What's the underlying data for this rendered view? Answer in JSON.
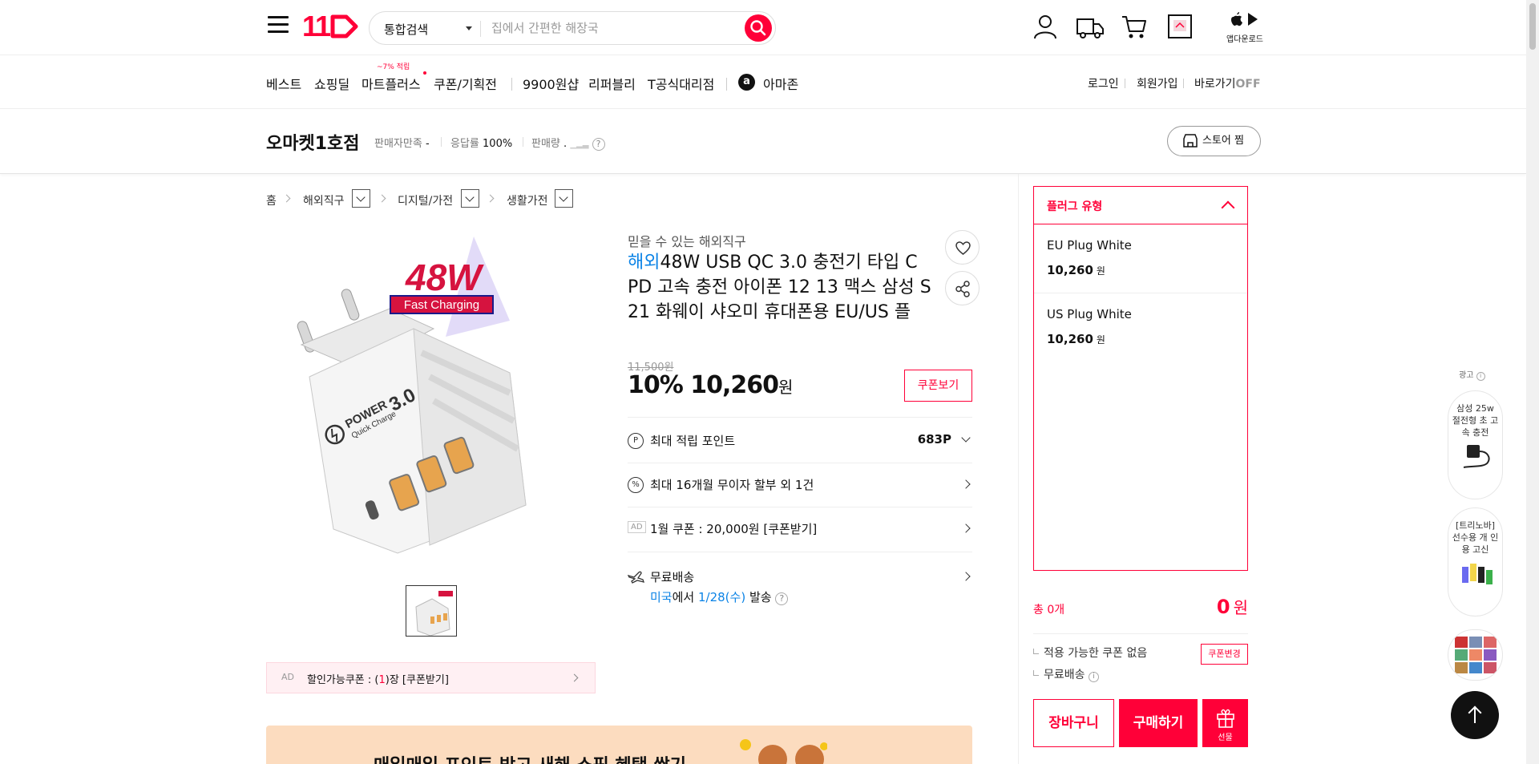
{
  "header": {
    "logo_text": "11",
    "search": {
      "category": "통합검색",
      "placeholder": "집에서 간편한 해장국"
    },
    "app_download": "앱다운로드"
  },
  "gnb": {
    "items": [
      "베스트",
      "쇼핑딜",
      "마트플러스",
      "쿠폰/기획전",
      "9900원샵",
      "리퍼블리",
      "T공식대리점",
      "아마존"
    ],
    "mart_badge": "~7% 적립",
    "amazon_logo": "a",
    "right": {
      "login": "로그인",
      "join": "회원가입",
      "shortcut": "바로가기",
      "shortcut_state": "OFF"
    }
  },
  "seller": {
    "name": "오마켓1호점",
    "satisfaction_label": "판매자만족",
    "satisfaction_value": "-",
    "response_label": "응답률",
    "response_value": "100%",
    "sales_label": "판매량",
    "sales_value": ".",
    "help": "?",
    "store_button": "스토어 찜"
  },
  "breadcrumb": [
    "홈",
    "해외직구",
    "디지털/가전",
    "생활가전"
  ],
  "product": {
    "image_badge_watt": "48W",
    "image_badge_text": "Fast Charging",
    "image_print_main": "POWER",
    "image_print_sub": "Quick Charge",
    "image_print_version": "3.0",
    "pre_title": "믿을 수 있는 해외직구",
    "flag": "해외",
    "title": "48W USB QC 3.0 충전기 타입 C PD 고속 충전 아이폰 12 13 맥스 삼성 S21 화웨이 샤오미 휴대폰용 EU/US 플",
    "original_price": "11,500원",
    "discount": "10%",
    "price": "10,260",
    "currency": "원",
    "coupon_button": "쿠폰보기",
    "points_label": "최대 적립 포인트",
    "points_value": "683P",
    "installment": "최대 16개월 무이자 할부 외 1건",
    "ad_tag": "AD",
    "monthly_coupon": "1월 쿠폰 : 20,000원 [쿠폰받기]",
    "shipping": "무료배송",
    "ship_origin": "미국",
    "ship_mid": "에서 ",
    "ship_date": "1/28(수)",
    "ship_suffix": " 발송",
    "points_icon": "P",
    "installment_icon": "%",
    "help": "?"
  },
  "discount_coupon": {
    "ad_tag": "AD",
    "prefix": "할인가능쿠폰 : (",
    "count": "1",
    "suffix": ")장 [쿠폰받기]"
  },
  "banner": {
    "text": "매일매일 포인트 받고 새해 쇼핑 혜택 쌓기"
  },
  "options": {
    "header": "플러그 유형",
    "items": [
      {
        "name": "EU Plug White",
        "price": "10,260",
        "unit": "원"
      },
      {
        "name": "US Plug White",
        "price": "10,260",
        "unit": "원"
      }
    ]
  },
  "order": {
    "count": "총 0개",
    "total": "0",
    "total_unit": "원",
    "coupon_status": "적용 가능한 쿠폰 없음",
    "coupon_change": "쿠폰변경",
    "shipping": "무료배송",
    "cart": "장바구니",
    "buy": "구매하기",
    "gift": "선물"
  },
  "side_ads": {
    "label": "광고",
    "items": [
      "삼성 25w 절전형 초 고속 충전",
      "[트리노바] 선수용 개 인용 고신"
    ]
  },
  "colors": {
    "brand": "#ff0038",
    "link_blue": "#0b83e6"
  }
}
